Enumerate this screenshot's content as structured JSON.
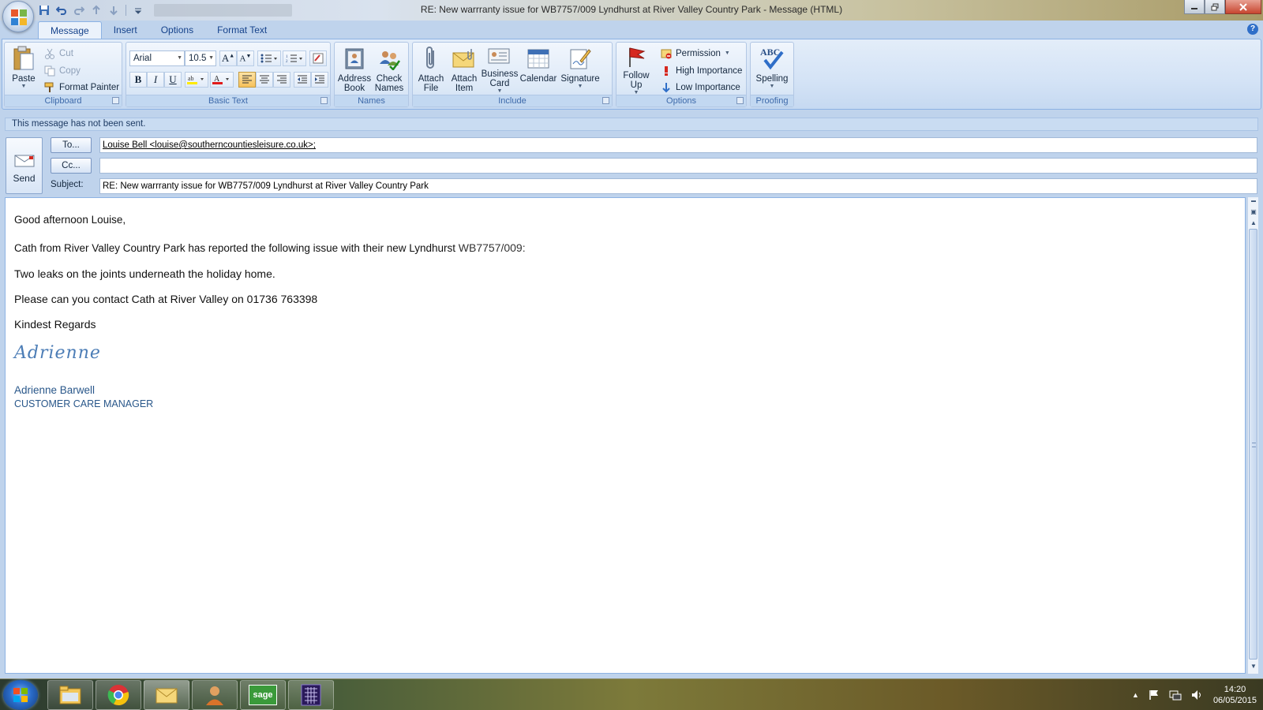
{
  "window": {
    "title": "RE: New warrranty issue for WB7757/009 Lyndhurst at River Valley Country Park - Message (HTML)"
  },
  "ribbon": {
    "tabs": [
      "Message",
      "Insert",
      "Options",
      "Format Text"
    ],
    "active_tab": "Message",
    "clipboard": {
      "paste": "Paste",
      "cut": "Cut",
      "copy": "Copy",
      "format_painter": "Format Painter",
      "label": "Clipboard"
    },
    "basic_text": {
      "font": "Arial",
      "size": "10.5",
      "label": "Basic Text"
    },
    "names": {
      "address_book": [
        "Address",
        "Book"
      ],
      "check_names": [
        "Check",
        "Names"
      ],
      "label": "Names"
    },
    "include": {
      "attach_file": [
        "Attach",
        "File"
      ],
      "attach_item": [
        "Attach",
        "Item"
      ],
      "business_card": [
        "Business",
        "Card"
      ],
      "calendar": "Calendar",
      "signature": "Signature",
      "label": "Include"
    },
    "options": {
      "follow_up": [
        "Follow",
        "Up"
      ],
      "permission": "Permission",
      "high_importance": "High Importance",
      "low_importance": "Low Importance",
      "label": "Options"
    },
    "proofing": {
      "spelling": "Spelling",
      "abc": "ABC",
      "label": "Proofing"
    }
  },
  "message": {
    "info": "This message has not been sent.",
    "send_label": "Send",
    "to_button": "To...",
    "cc_button": "Cc...",
    "subject_label": "Subject:",
    "to_value": "Louise Bell <louise@southerncountiesleisure.co.uk>;",
    "cc_value": "",
    "subject_value": "RE: New warrranty issue for WB7757/009 Lyndhurst at River Valley Country Park"
  },
  "body": {
    "greeting": "Good afternoon Louise,",
    "line1_a": "Cath from River Valley Country Park has reported the following issue with their new Lyndhurst ",
    "line1_b": "WB7757/009:",
    "line2": "Two leaks on the joints underneath the holiday home.",
    "line3": "Please can you contact Cath at River Valley  on 01736 763398",
    "line4": "Kindest Regards",
    "signature_script": "Adrienne",
    "signature_name": "Adrienne Barwell",
    "signature_title": "CUSTOMER CARE MANAGER"
  },
  "taskbar": {
    "time": "14:20",
    "date": "06/05/2015",
    "sage_label": "sage"
  },
  "colors": {
    "ribbon_blue": "#dbe7f6",
    "tab_text": "#15428b",
    "signature_blue": "#29578a"
  }
}
